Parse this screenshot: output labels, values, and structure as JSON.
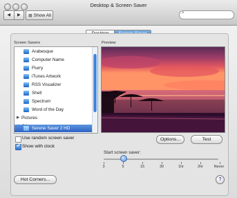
{
  "window": {
    "title": "Desktop & Screen Saver"
  },
  "toolbar": {
    "back_label": "◀",
    "forward_label": "▶",
    "show_all_label": "Show All",
    "search_placeholder": ""
  },
  "tabs": [
    {
      "label": "Desktop",
      "selected": false
    },
    {
      "label": "Screen Saver",
      "selected": true
    }
  ],
  "screen_savers": {
    "label": "Screen Savers",
    "items": [
      {
        "label": "Arabesque",
        "type": "saver"
      },
      {
        "label": "Computer Name",
        "type": "saver"
      },
      {
        "label": "Flurry",
        "type": "saver"
      },
      {
        "label": "iTunes Artwork",
        "type": "saver"
      },
      {
        "label": "RSS Visualizer",
        "type": "saver"
      },
      {
        "label": "Shell",
        "type": "saver"
      },
      {
        "label": "Spectrum",
        "type": "saver"
      },
      {
        "label": "Word of the Day",
        "type": "saver"
      },
      {
        "label": "Pictures",
        "type": "group",
        "expanded": false
      },
      {
        "label": "Other",
        "type": "group",
        "expanded": true
      },
      {
        "label": "Serene Saver 2 HD",
        "type": "saver",
        "selected": true
      }
    ]
  },
  "preview": {
    "label": "Preview"
  },
  "options": {
    "random_label": "Use random screen saver",
    "random_checked": false,
    "clock_label": "Show with clock",
    "clock_checked": true
  },
  "buttons": {
    "options_label": "Options...",
    "test_label": "Test",
    "hot_corners_label": "Hot Corners...",
    "help_label": "?"
  },
  "start": {
    "label": "Start screen saver:",
    "ticks": [
      "3",
      "5",
      "15",
      "30",
      "1hr",
      "2hr",
      "Never"
    ],
    "selected": "5"
  },
  "colors": {
    "selection": "#2f63c3",
    "accent": "#3272c8"
  }
}
